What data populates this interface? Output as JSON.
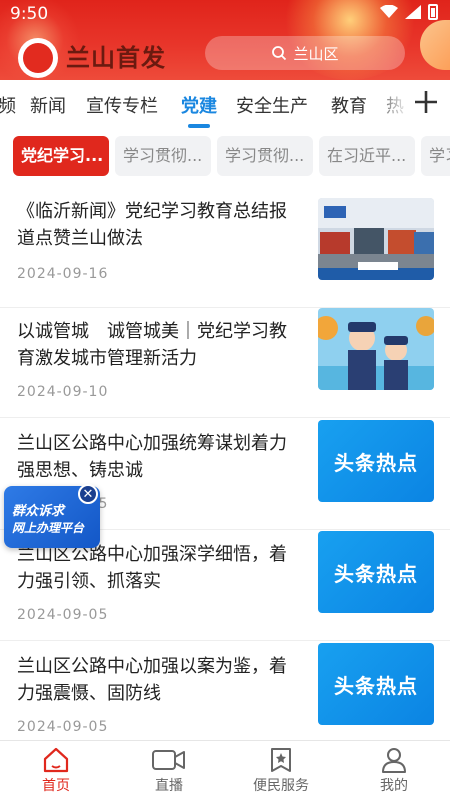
{
  "status_bar": {
    "time": "9:50"
  },
  "header": {
    "app_title": "兰山首发",
    "search_placeholder": "兰山区"
  },
  "tabs": [
    "频",
    "新闻",
    "宣传专栏",
    "党建",
    "安全生产",
    "教育",
    "热"
  ],
  "active_tab": "党建",
  "chips": [
    "党纪学习...",
    "学习贯彻...",
    "学习贯彻...",
    "在习近平...",
    "学习"
  ],
  "news": [
    {
      "title": "《临沂新闻》党纪学习教育总结报道点赞兰山做法",
      "date": "2024-09-16",
      "thumb": "trucks"
    },
    {
      "title": "以诚管城　诚管城美｜党纪学习教育激发城市管理新活力",
      "date": "2024-09-10",
      "thumb": "officers"
    },
    {
      "title": "兰山区公路中心加强统筹谋划着力强思想、铸忠诚",
      "date": "2024-09-05",
      "thumb": "hot",
      "thumb_text": "头条热点"
    },
    {
      "title": "兰山区公路中心加强深学细悟，着力强引领、抓落实",
      "date": "2024-09-05",
      "thumb": "hot",
      "thumb_text": "头条热点"
    },
    {
      "title": "兰山区公路中心加强以案为鉴，着力强震慑、固防线",
      "date": "2024-09-05",
      "thumb": "hot",
      "thumb_text": "头条热点"
    }
  ],
  "float_badge": {
    "line1": "群众诉求",
    "line2": "网上办理平台"
  },
  "bottom_nav": [
    {
      "label": "首页",
      "icon": "home-icon",
      "active": true
    },
    {
      "label": "直播",
      "icon": "video-icon",
      "active": false
    },
    {
      "label": "便民服务",
      "icon": "service-icon",
      "active": false
    },
    {
      "label": "我的",
      "icon": "user-icon",
      "active": false
    }
  ],
  "colors": {
    "brand_red": "#e0281d",
    "accent_blue": "#1a87e0",
    "hot_blue": "#0b84e3"
  }
}
